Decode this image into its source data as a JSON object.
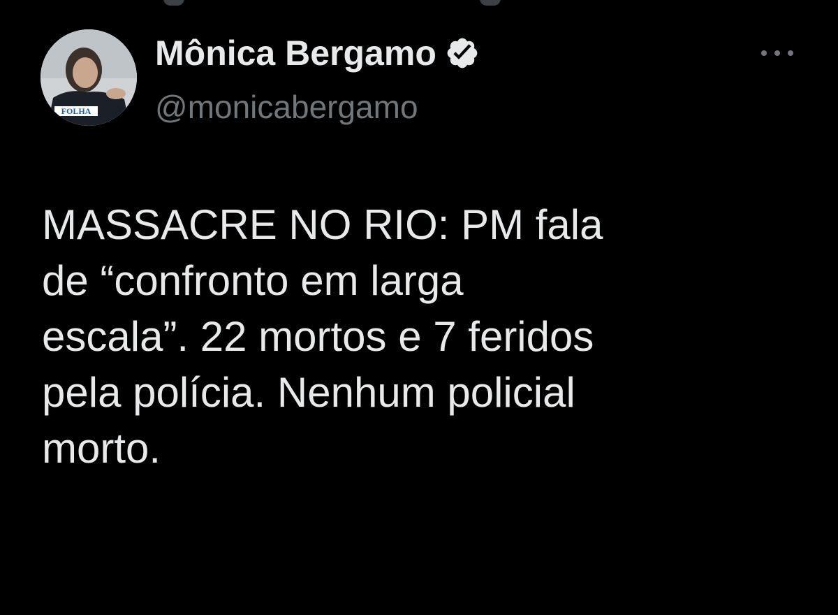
{
  "tweet": {
    "author": {
      "display_name": "Mônica Bergamo",
      "handle": "@monicabergamo",
      "verified": true,
      "avatar_badge": "FOLHA"
    },
    "text": "MASSACRE NO RIO: PM fala\nde “confronto em larga\nescala”. 22 mortos e 7 feridos\npela polícia. Nenhum policial\nmorto.",
    "more_menu_icon": "more-horizontal-icon"
  },
  "colors": {
    "background": "#000000",
    "primary_text": "#e7e9ea",
    "secondary_text": "#71767b",
    "verified_badge": "#e7e9ea"
  }
}
